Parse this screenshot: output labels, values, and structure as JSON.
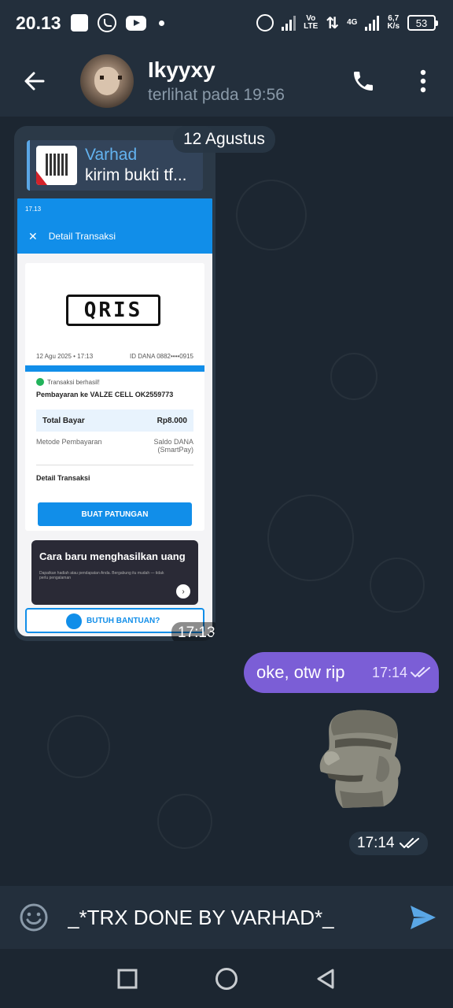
{
  "status_bar": {
    "time": "20.13",
    "volte": "Vo\nLTE",
    "network": "4G",
    "speed": "6,7\nK/s",
    "battery": "53"
  },
  "header": {
    "contact_name": "Ikyyxy",
    "last_seen": "terlihat pada  19:56"
  },
  "chat": {
    "date_chip": "12 Agustus",
    "image_message": {
      "reply_name": "Varhad",
      "reply_text": "kirim bukti tf...",
      "time": "17:13",
      "screenshot": {
        "status_time": "17.13",
        "title": "Detail Transaksi",
        "logo": "QRIS",
        "date": "12 Agu 2025 • 17:13",
        "id_dana": "ID DANA 0882••••0915",
        "success": "Transaksi berhasil!",
        "pay_to": "Pembayaran ke VALZE CELL OK2559773",
        "total_label": "Total Bayar",
        "total_value": "Rp8.000",
        "method_label": "Metode Pembayaran",
        "method_value": "Saldo DANA (SmartPay)",
        "detail_label": "Detail Transaksi",
        "patungan_button": "BUAT PATUNGAN",
        "promo_title": "Cara baru menghasilkan uang",
        "promo_desc": "Dapatkan hadiah atau pendapatan Anda. Bergabung itu mudah — tidak perlu pengalaman",
        "help_button": "BUTUH BANTUAN?"
      }
    },
    "outgoing_message": {
      "text": "oke, otw rip",
      "time": "17:14"
    },
    "sticker": {
      "time": "17:14"
    }
  },
  "input": {
    "value": "_*TRX DONE BY VARHAD*_"
  },
  "colors": {
    "header_bg": "#232f3c",
    "chat_bg": "#1c2631",
    "outgoing_bubble": "#7b5ed6",
    "accent_blue": "#5aa7e6",
    "dana_blue": "#118ee9"
  }
}
